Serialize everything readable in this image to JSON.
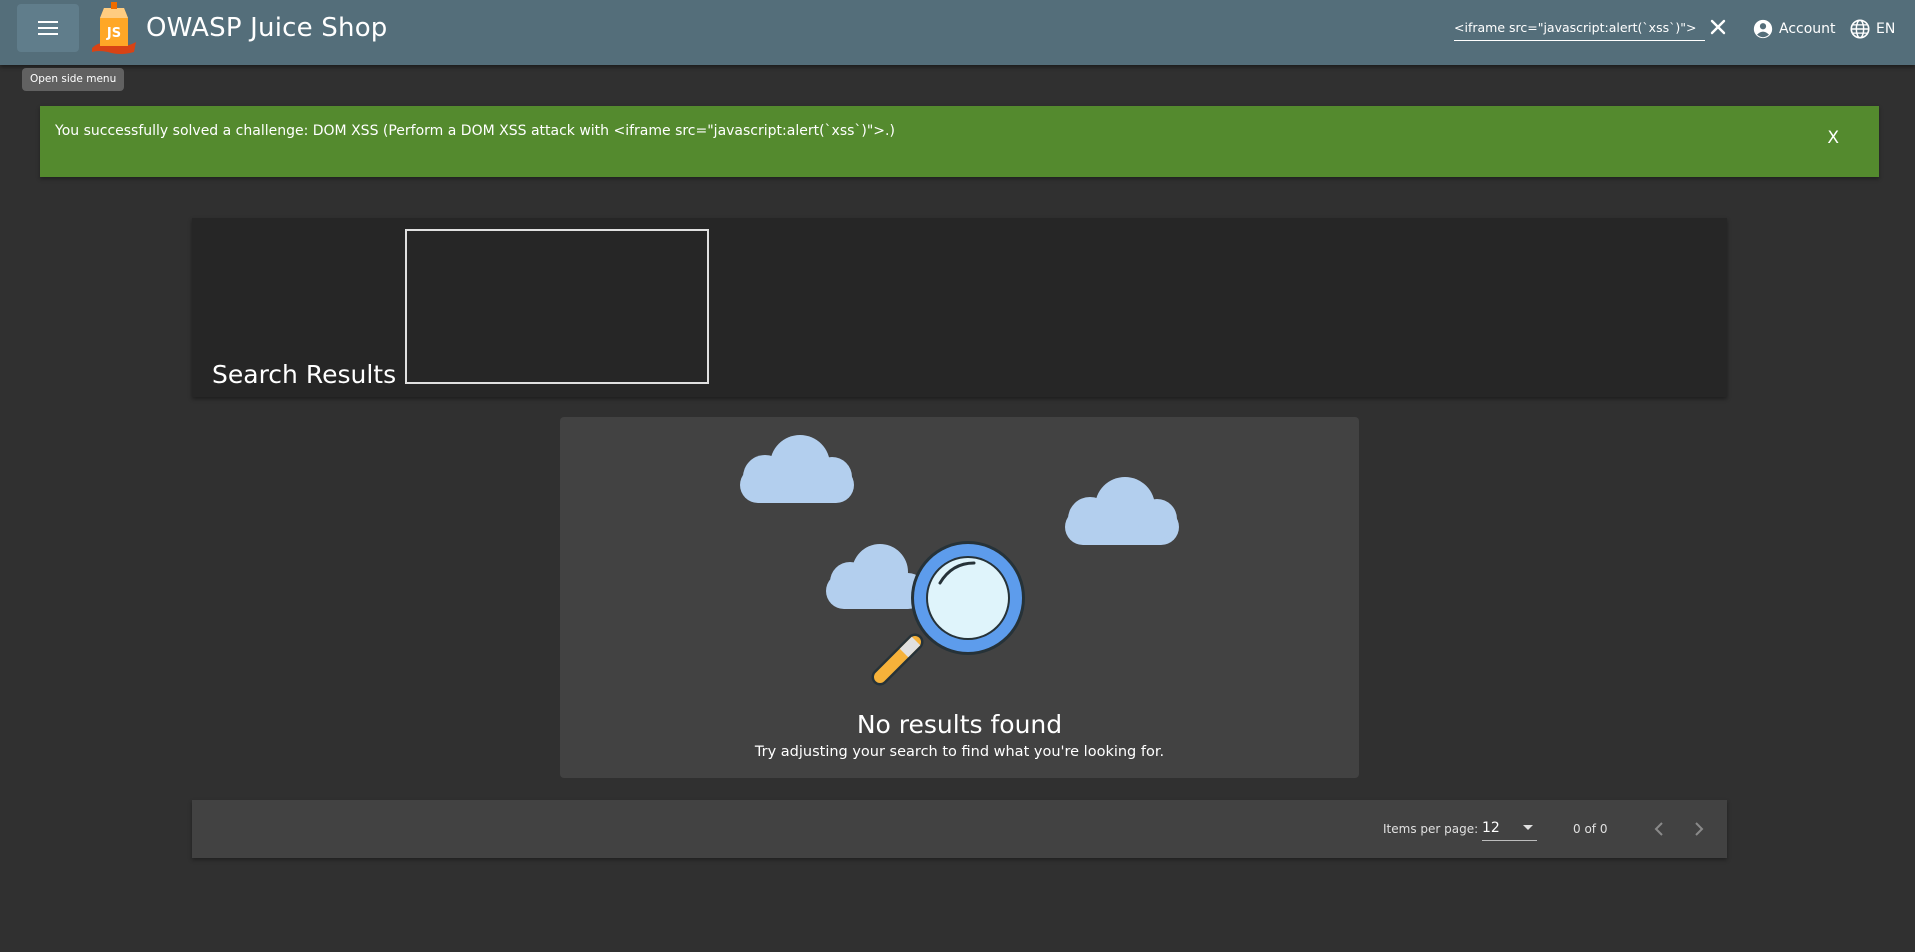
{
  "header": {
    "title": "OWASP Juice Shop",
    "logo_text": "JS",
    "menu_tooltip": "Open side menu",
    "search_value": "<iframe src=\"javascript:alert(`xss`)\">",
    "account_label": "Account",
    "language_label": "EN"
  },
  "banner": {
    "message": "You successfully solved a challenge: DOM XSS (Perform a DOM XSS attack with <iframe src=\"javascript:alert(`xss`)\">.)",
    "close_label": "X",
    "color": "#548a2e"
  },
  "results": {
    "heading": "Search Results -"
  },
  "empty_state": {
    "title": "No results found",
    "subtitle": "Try adjusting your search to find what you're looking for."
  },
  "paginator": {
    "items_per_page_label": "Items per page:",
    "items_per_page_value": "12",
    "range_label": "0 of 0"
  },
  "colors": {
    "toolbar": "#546e7a",
    "background": "#303030",
    "card": "#424242"
  },
  "icons": [
    "menu-icon",
    "close-icon",
    "account-circle-icon",
    "globe-icon",
    "chevron-left-icon",
    "chevron-right-icon",
    "dropdown-arrow-icon"
  ]
}
